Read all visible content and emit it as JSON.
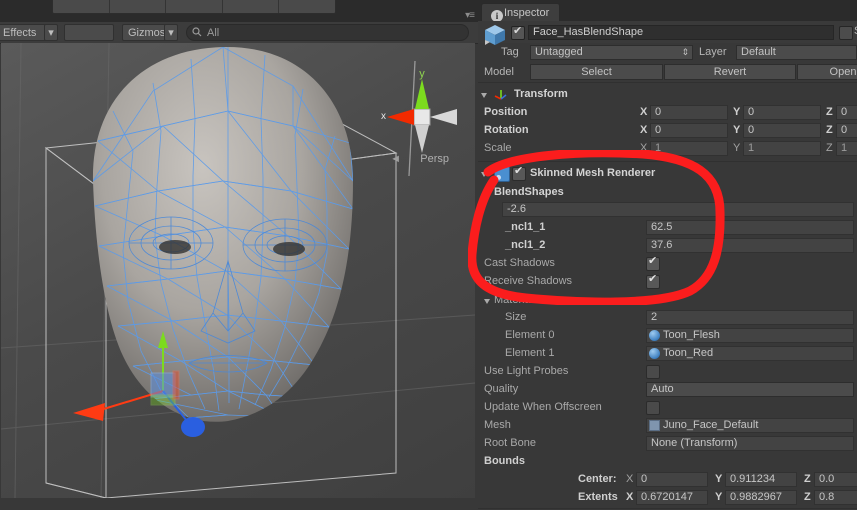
{
  "scene_toolbar": {
    "effects_label": "Effects",
    "effects_arrow": "▾",
    "gizmos_label": "Gizmos",
    "gizmos_arrow": "▾",
    "search_value": "All",
    "menu_glyph": "▾≡"
  },
  "scene_gizmo": {
    "x_label": "x",
    "y_label": "y",
    "perspective_label": "Persp",
    "perspective_arrow": "◄",
    "axis_x_color": "#ff2d00",
    "axis_y_color": "#7cdb1e",
    "axis_z_color": "#2a5fe0"
  },
  "inspector": {
    "tab_label": "Inspector",
    "tab_icon": "i",
    "object_name": "Face_HasBlendShape",
    "static_label": "S",
    "tag_label": "Tag",
    "tag_value": "Untagged",
    "layer_label": "Layer",
    "layer_value": "Default",
    "model_label": "Model",
    "model_buttons": [
      "Select",
      "Revert",
      "Open"
    ],
    "transform": {
      "title": "Transform",
      "rows": [
        {
          "label": "Position",
          "bold": true,
          "x": "0",
          "y": "0",
          "z": "0"
        },
        {
          "label": "Rotation",
          "bold": true,
          "x": "0",
          "y": "0",
          "z": "0"
        },
        {
          "label": "Scale",
          "bold": false,
          "x": "1",
          "y": "1",
          "z": "1"
        }
      ],
      "axis_labels": [
        "X",
        "Y",
        "Z"
      ]
    },
    "skinned_mesh_renderer": {
      "title": "Skinned Mesh Renderer",
      "enabled": true,
      "blendshapes_title": "BlendShapes",
      "blendshapes": [
        {
          "name": "-2.6",
          "value": ""
        },
        {
          "name": "_ncl1_1",
          "value": "62.5"
        },
        {
          "name": "_ncl1_2",
          "value": "37.6"
        }
      ],
      "cast_shadows_label": "Cast Shadows",
      "cast_shadows_checked": true,
      "receive_shadows_label": "Receive Shadows",
      "receive_shadows_checked": true,
      "materials_title": "Materials",
      "size_label": "Size",
      "size_value": "2",
      "elements": [
        {
          "label": "Element 0",
          "value": "Toon_Flesh"
        },
        {
          "label": "Element 1",
          "value": "Toon_Red"
        }
      ],
      "use_light_probes_label": "Use Light Probes",
      "use_light_probes_checked": false,
      "quality_label": "Quality",
      "quality_value": "Auto",
      "update_offscreen_label": "Update When Offscreen",
      "update_offscreen_checked": false,
      "mesh_label": "Mesh",
      "mesh_value": "Juno_Face_Default",
      "root_bone_label": "Root Bone",
      "root_bone_value": "None (Transform)",
      "bounds_label": "Bounds",
      "center_label": "Center:",
      "center": {
        "x": "0",
        "y": "0.911234",
        "z": "0.0"
      },
      "extents_label": "Extents",
      "extents": {
        "x": "0.6720147",
        "y": "0.9882967",
        "z": "0.8"
      },
      "axis_labels": [
        "X",
        "Y",
        "Z"
      ]
    }
  },
  "annotation": {
    "shape": "hand-drawn-red-ellipse",
    "color": "#fb1d1d",
    "target": "BlendShapes section"
  }
}
